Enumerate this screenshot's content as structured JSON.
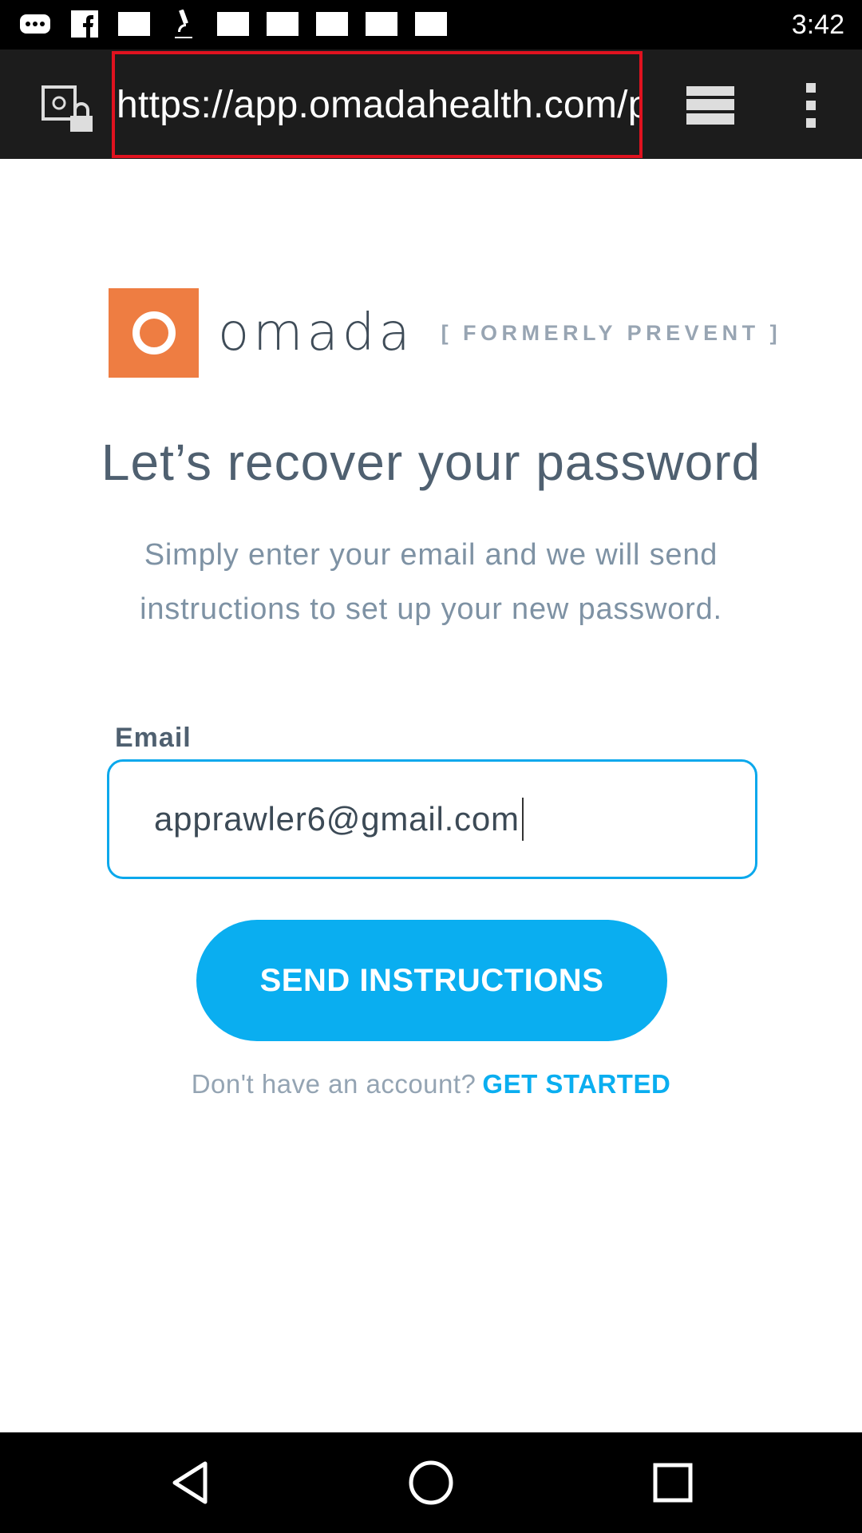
{
  "status_bar": {
    "time": "3:42",
    "icons": [
      "more-notifications-icon",
      "facebook-icon",
      "image-icon",
      "microscope-icon",
      "image-icon",
      "image-icon",
      "image-icon",
      "image-icon",
      "image-icon"
    ]
  },
  "browser": {
    "url": "https://app.omadahealth.com/p",
    "url_highlight_color": "#e0121f"
  },
  "logo": {
    "wordmark": "omada",
    "formerly": "[ FORMERLY PREVENT ]",
    "brand_color": "#ee7d42"
  },
  "page": {
    "title": "Let’s recover your password",
    "subtitle": "Simply enter your email and we will send instructions to set up your new password.",
    "email_label": "Email",
    "email_value": "apprawler6@gmail.com",
    "send_button": "SEND INSTRUCTIONS",
    "no_account_text": "Don't have an account?",
    "get_started_link": "GET STARTED",
    "accent_color": "#0aaef0"
  },
  "nav": {
    "icons": [
      "back-icon",
      "home-icon",
      "recents-icon"
    ]
  }
}
